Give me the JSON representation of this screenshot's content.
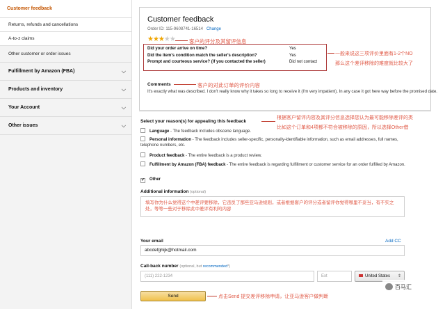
{
  "sidebar": {
    "header": "Customer feedback",
    "links": [
      "Returns, refunds and cancellations",
      "A-to-z claims",
      "Other customer or order issues"
    ],
    "sections": [
      "Fulfillment by Amazon (FBA)",
      "Products and inventory",
      "Your Account",
      "Other issues"
    ],
    "chevron_icon": "chevron-down-icon"
  },
  "panel": {
    "title": "Customer feedback",
    "order_id_label": "Order ID: 115-9608741-16514",
    "change_link": "Change",
    "rating": 3,
    "rating_max": 5,
    "questions": [
      {
        "q": "Did your order arrive on time?",
        "a": "Yes"
      },
      {
        "q": "Did the item's condition match the seller's description?",
        "a": "Yes"
      },
      {
        "q": "Prompt and courteous service? (if you contacted the seller)",
        "a": "Did not contact"
      }
    ],
    "comments_label": "Comments",
    "comments_text": "It's exactly what was described. I don't really know why it takes so long to receive it (I'm very impatient). In any case it got here way before the promised date."
  },
  "annotations": {
    "rating": "客户的评分及其留评信息",
    "questions": "一般来说这三项评价里面有1-2个NO",
    "questions2": "那么这个差评移除的难度就比较大了",
    "comments": "客户的对此订单的评价内容",
    "reasons": "根据客户留评内容及其评分信息选择您认为最可能移除差评的类",
    "reasons2": "比如这个订单和4项都不符合被移除的原因，所以选择Other借",
    "send": "点击Send 提交差评移除申请，让亚马逊客户做判断"
  },
  "form": {
    "reasons_heading": "Select your reason(s) for appealing this feedback",
    "reasons": [
      {
        "title": "Language",
        "desc": " - The feedback includes obscene language.",
        "checked": false
      },
      {
        "title": "Personal information",
        "desc": " - The feedback includes seller-specific, personally-identifiable information, such as email addresses, full names, telephone numbers, etc.",
        "checked": false
      },
      {
        "title": "Product feedback",
        "desc": " - The entire feedback is a product review.",
        "checked": false
      },
      {
        "title": "Fulfillment by Amazon (FBA) feedback",
        "desc": " - The entire feedback is regarding fulfillment or customer service for an order fulfilled by Amazon.",
        "checked": false
      },
      {
        "title": "Other",
        "desc": "",
        "checked": true
      }
    ],
    "additional_label": "Additional information",
    "additional_optional": "(optional)",
    "additional_value": "填写你为什么觉得这个中差评要移除，它违反了那些亚马逊规则，或者根据客户的评分或者留评你觉得哪里不妥当，有不实之处，等等一些对于移除此中差评有利的内容",
    "email_label": "Your email",
    "add_cc": "Add CC",
    "email_value": "abcdefghijk@hotmail.com",
    "callback_label": "Call-back number",
    "callback_optional": "(optional, but",
    "callback_recommended": "recommended",
    "callback_tail": "*)",
    "phone_placeholder": "(111) 222-1234",
    "ext_placeholder": "Ext",
    "country": "United States",
    "send_label": "Send"
  },
  "watermark": "百马汇"
}
